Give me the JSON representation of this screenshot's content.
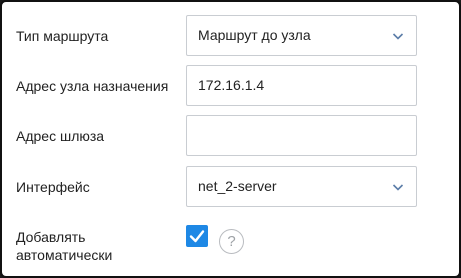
{
  "form": {
    "route_type": {
      "label": "Тип маршрута",
      "value": "Маршрут до узла",
      "icon": "chevron-down-icon"
    },
    "destination": {
      "label": "Адрес узла назначения",
      "value": "172.16.1.4"
    },
    "gateway": {
      "label": "Адрес шлюза",
      "value": ""
    },
    "interface": {
      "label": "Интерфейс",
      "value": "net_2-server",
      "icon": "chevron-down-icon"
    },
    "auto_add": {
      "label_line1": "Добавлять",
      "label_line2": "автоматически",
      "checked": true,
      "help_glyph": "?"
    }
  },
  "colors": {
    "accent": "#1e88e5",
    "border": "#c9cdd2",
    "text": "#222222",
    "chevron": "#5b7da8"
  }
}
